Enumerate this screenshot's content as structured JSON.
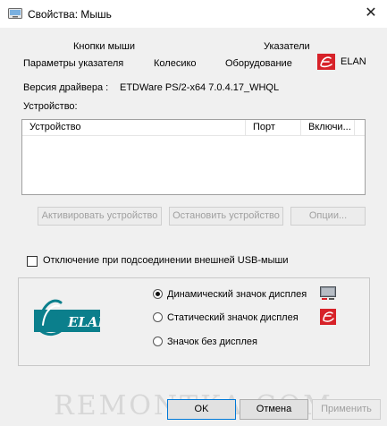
{
  "window": {
    "title": "Свойства: Мышь",
    "close_glyph": "✕"
  },
  "tabs_row1": {
    "buttons": "Кнопки мыши",
    "pointers": "Указатели"
  },
  "tabs_row2": {
    "pointer_options": "Параметры указателя",
    "wheel": "Колесико",
    "hardware": "Оборудование",
    "elan": "ELAN"
  },
  "driver": {
    "label": "Версия драйвера :",
    "value": "ETDWare PS/2-x64 7.0.4.17_WHQL"
  },
  "devices": {
    "label": "Устройство:",
    "columns": [
      "Устройство",
      "Порт",
      "Включи..."
    ]
  },
  "device_buttons": {
    "activate": "Активировать устройство",
    "stop": "Остановить устройство",
    "options": "Опции..."
  },
  "usb_checkbox": {
    "label": "Отключение при подсоединении внешней USB-мыши",
    "checked": false
  },
  "tray_icon": {
    "logo_text": "ELAN",
    "options": [
      {
        "label": "Динамический значок дисплея",
        "selected": true,
        "icon": "monitor-tray-icon"
      },
      {
        "label": "Статический значок дисплея",
        "selected": false,
        "icon": "elan-tray-icon"
      },
      {
        "label": "Значок без дисплея",
        "selected": false
      }
    ]
  },
  "footer": {
    "ok": "OK",
    "cancel": "Отмена",
    "apply": "Применить"
  },
  "watermark": "REMONTKA.COM",
  "colors": {
    "elan_teal": "#0b7f8c",
    "elan_red": "#d72229",
    "focus_blue": "#0078d7"
  }
}
